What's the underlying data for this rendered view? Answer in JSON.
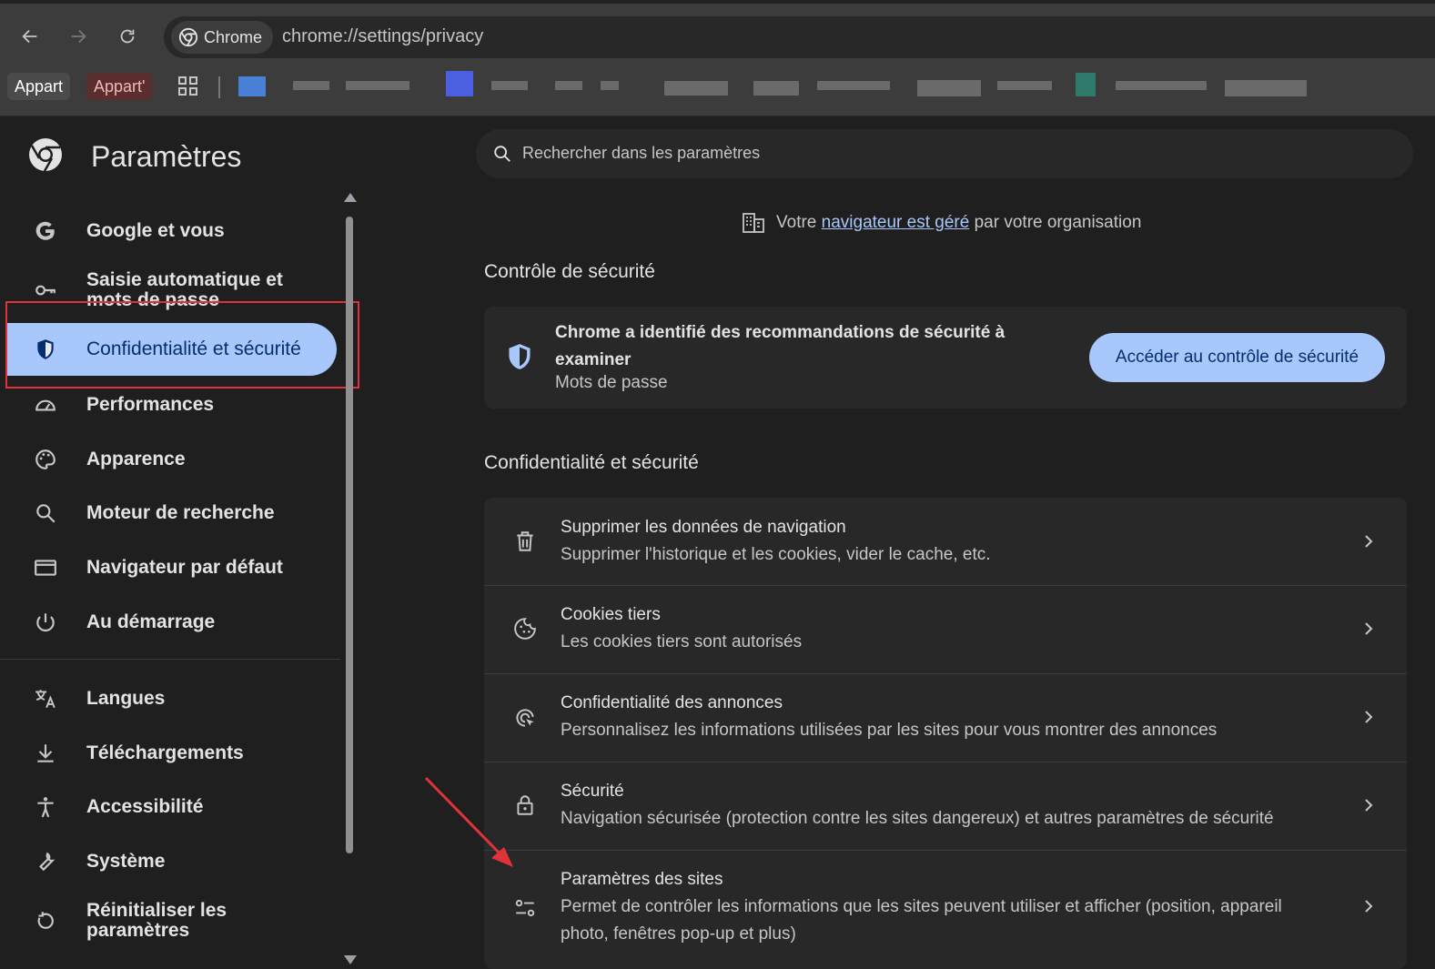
{
  "browser": {
    "omnibox_chip": "Chrome",
    "url": "chrome://settings/privacy",
    "bookmarks": [
      "Appart",
      "Appart'"
    ]
  },
  "sidebar": {
    "title": "Paramètres",
    "items": [
      {
        "label": "Google et vous",
        "icon": "google-icon"
      },
      {
        "label": "Saisie automatique et mots de passe",
        "icon": "key-icon"
      },
      {
        "label": "Confidentialité et sécurité",
        "icon": "shield-icon",
        "active": true
      },
      {
        "label": "Performances",
        "icon": "speedometer-icon"
      },
      {
        "label": "Apparence",
        "icon": "palette-icon"
      },
      {
        "label": "Moteur de recherche",
        "icon": "search-icon"
      },
      {
        "label": "Navigateur par défaut",
        "icon": "browser-window-icon"
      },
      {
        "label": "Au démarrage",
        "icon": "power-icon"
      },
      {
        "label": "Langues",
        "icon": "translate-icon"
      },
      {
        "label": "Téléchargements",
        "icon": "download-icon"
      },
      {
        "label": "Accessibilité",
        "icon": "accessibility-icon"
      },
      {
        "label": "Système",
        "icon": "wrench-icon"
      },
      {
        "label": "Réinitialiser les paramètres",
        "icon": "reset-icon"
      }
    ]
  },
  "search": {
    "placeholder": "Rechercher dans les paramètres"
  },
  "managed": {
    "prefix": "Votre",
    "link": "navigateur est géré",
    "suffix": "par votre organisation"
  },
  "safety": {
    "section_title": "Contrôle de sécurité",
    "title": "Chrome a identifié des recommandations de sécurité à examiner",
    "subtitle": "Mots de passe",
    "button": "Accéder au contrôle de sécurité"
  },
  "privacy": {
    "section_title": "Confidentialité et sécurité",
    "rows": [
      {
        "title": "Supprimer les données de navigation",
        "subtitle": "Supprimer l'historique et les cookies, vider le cache, etc."
      },
      {
        "title": "Cookies tiers",
        "subtitle": "Les cookies tiers sont autorisés"
      },
      {
        "title": "Confidentialité des annonces",
        "subtitle": "Personnalisez les informations utilisées par les sites pour vous montrer des annonces"
      },
      {
        "title": "Sécurité",
        "subtitle": "Navigation sécurisée (protection contre les sites dangereux) et autres paramètres de sécurité"
      },
      {
        "title": "Paramètres des sites",
        "subtitle": "Permet de contrôler les informations que les sites peuvent utiliser et afficher (position, appareil photo, fenêtres pop-up et plus)"
      }
    ]
  },
  "colors": {
    "accent": "#a8c7fa",
    "highlight": "#e0323b",
    "background": "#1f1f1f",
    "card": "#282828"
  }
}
